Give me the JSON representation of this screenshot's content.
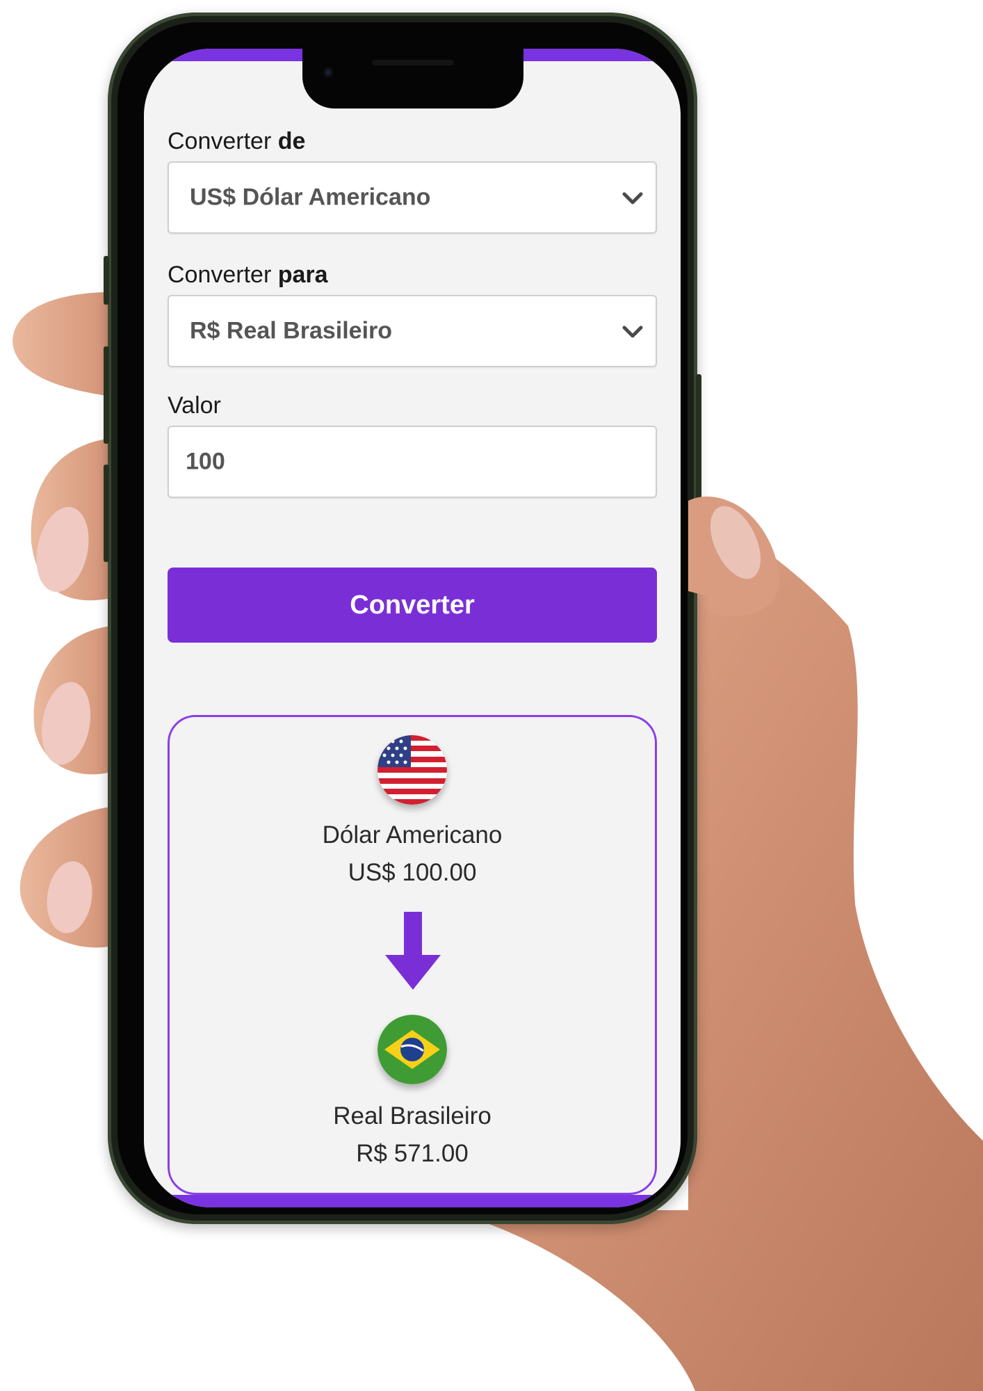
{
  "form": {
    "from_label_prefix": "Converter",
    "from_label_strong": "de",
    "from_value": "US$ Dólar Americano",
    "to_label_prefix": "Converter",
    "to_label_strong": "para",
    "to_value": "R$ Real Brasileiro",
    "amount_label": "Valor",
    "amount_value": "100",
    "convert_button": "Converter"
  },
  "result": {
    "from_name": "Dólar Americano",
    "from_amount": "US$ 100.00",
    "to_name": "Real Brasileiro",
    "to_amount": "R$ 571.00",
    "from_flag_icon": "usa-flag-icon",
    "to_flag_icon": "brazil-flag-icon",
    "arrow_icon": "arrow-down-icon"
  },
  "colors": {
    "accent": "#7a2fd6",
    "card_border": "#8a3ee6",
    "screen_bg": "#f3f3f3"
  }
}
